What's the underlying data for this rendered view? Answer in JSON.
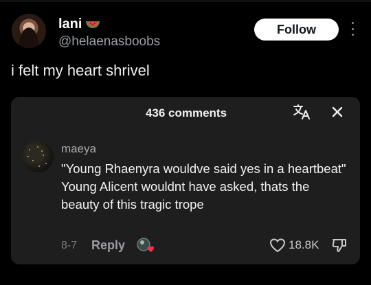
{
  "post": {
    "author_name": "lani",
    "author_handle": "@helaenasboobs",
    "follow_label": "Follow",
    "text": "i felt my heart shrivel",
    "name_emoji_icon": "watermelon-icon"
  },
  "comments_panel": {
    "count_label": "436 comments",
    "icons": [
      "translate-icon",
      "close-icon"
    ],
    "comment": {
      "username": "maeya",
      "text_line1": "\"Young Rhaenyra wouldve said yes in a heartbeat\"",
      "text_line2": "Young Alicent wouldnt have asked, thats the beauty of this tragic trope",
      "date": "8-7",
      "reply_label": "Reply",
      "like_count": "18.8K",
      "icons": [
        "creator-liked-icon",
        "heart-outline-icon",
        "thumbs-down-icon"
      ]
    }
  },
  "colors": {
    "background": "#000000",
    "card": "#1e1e1f",
    "heart_accent": "#fe2c55",
    "follow_bg": "#ffffff"
  }
}
